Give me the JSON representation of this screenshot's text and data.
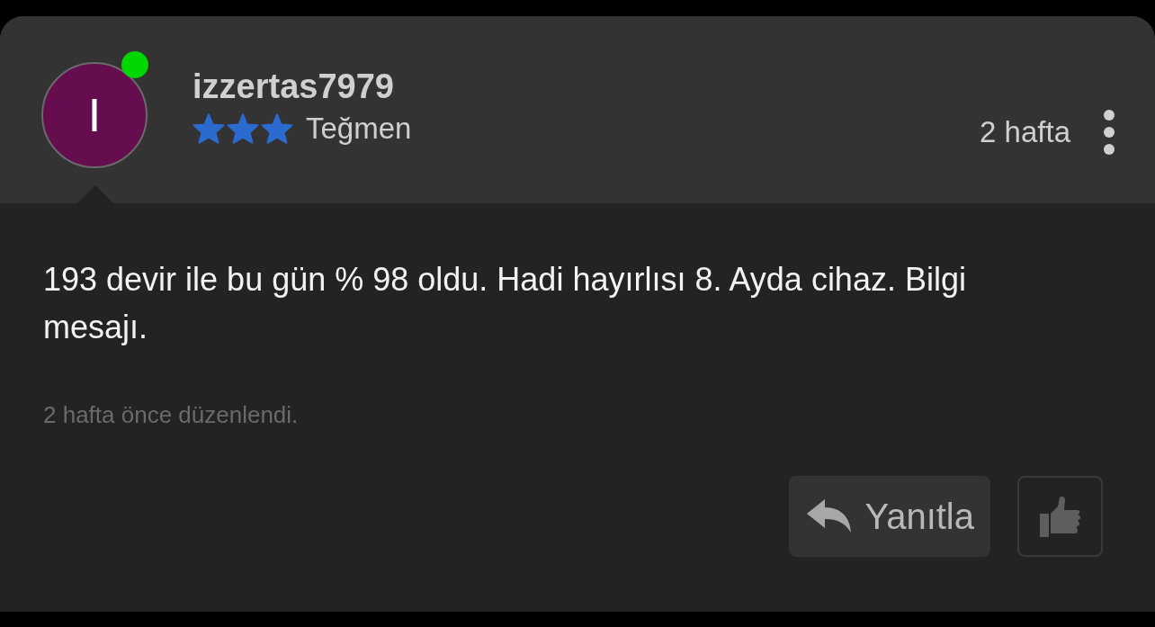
{
  "comment": {
    "author": {
      "initial": "I",
      "name": "izzertas7979",
      "online": true,
      "stars": 3,
      "rank": "Teğmen"
    },
    "time": "2 hafta",
    "message": "193 devir ile bu gün % 98 oldu. Hadi hayırlısı 8. Ayda cihaz. Bilgi mesajı.",
    "edited_note": "2 hafta önce düzenlendi.",
    "reply_button": {
      "label": "Yanıtla"
    }
  }
}
